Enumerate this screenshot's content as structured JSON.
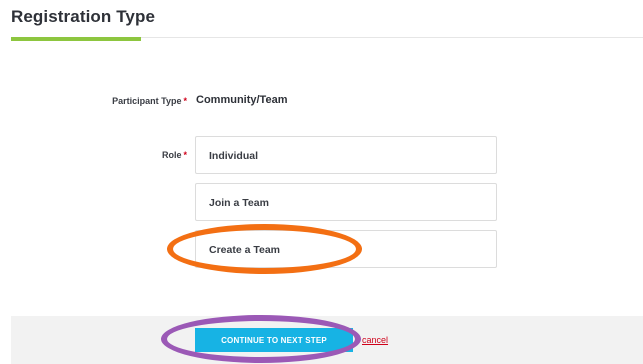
{
  "section": {
    "title": "Registration Type"
  },
  "participant_type": {
    "label": "Participant Type",
    "required_mark": "*",
    "value": "Community/Team"
  },
  "role": {
    "label": "Role",
    "required_mark": "*",
    "options": [
      {
        "label": "Individual"
      },
      {
        "label": "Join a Team"
      },
      {
        "label": "Create a Team"
      }
    ]
  },
  "actions": {
    "continue_label": "CONTINUE TO NEXT STEP",
    "cancel_label": "cancel"
  },
  "colors": {
    "accent_green": "#8dc63f",
    "button_blue": "#17b3e4",
    "required_red": "#d0021b",
    "annotation_orange": "#f36f13",
    "annotation_purple": "#9b59b6"
  }
}
